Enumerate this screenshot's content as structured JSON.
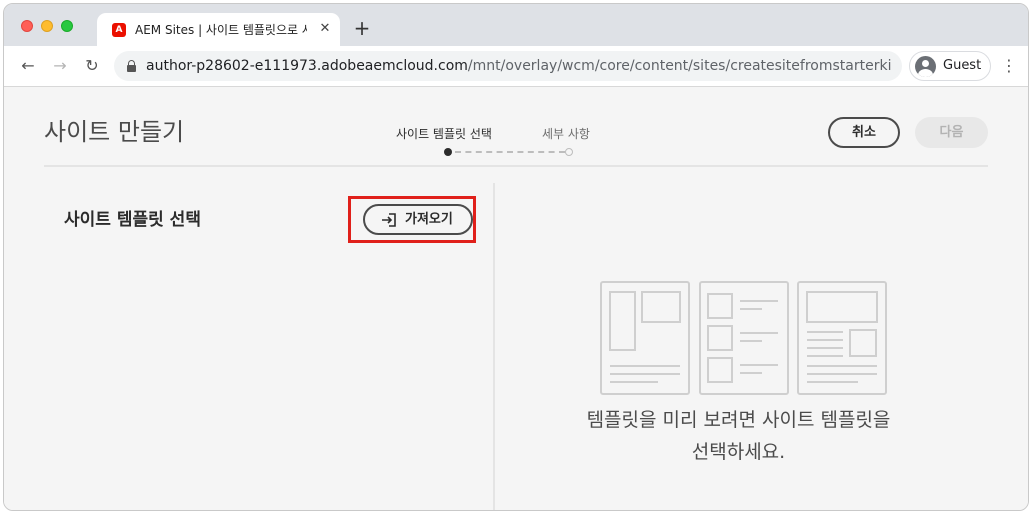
{
  "browser": {
    "tab": {
      "favicon": "adobe-logo",
      "title": "AEM Sites | 사이트 템플릿으로 사",
      "close_glyph": "✕"
    },
    "new_tab_glyph": "+",
    "nav": {
      "back_glyph": "←",
      "forward_glyph": "→",
      "reload_glyph": "↻"
    },
    "address": {
      "host": "author-p28602-e111973.adobeaemcloud.com",
      "path": "/mnt/overlay/wcm/core/content/sites/createsitefromstarterkitwiz..."
    },
    "profile": {
      "name": "Guest"
    },
    "menu_glyph": "⋮"
  },
  "wizard": {
    "title": "사이트 만들기",
    "steps": [
      {
        "label": "사이트 템플릿 선택",
        "active": true
      },
      {
        "label": "세부 사항",
        "active": false
      }
    ],
    "cancel_label": "취소",
    "next_label": "다음"
  },
  "left_panel": {
    "title": "사이트 템플릿 선택",
    "import_label": "가져오기",
    "import_icon": "import-icon",
    "highlight_color": "#e0201a"
  },
  "right_panel": {
    "empty_message_line1": "템플릿을 미리 보려면 사이트 템플릿을",
    "empty_message_line2": "선택하세요."
  }
}
